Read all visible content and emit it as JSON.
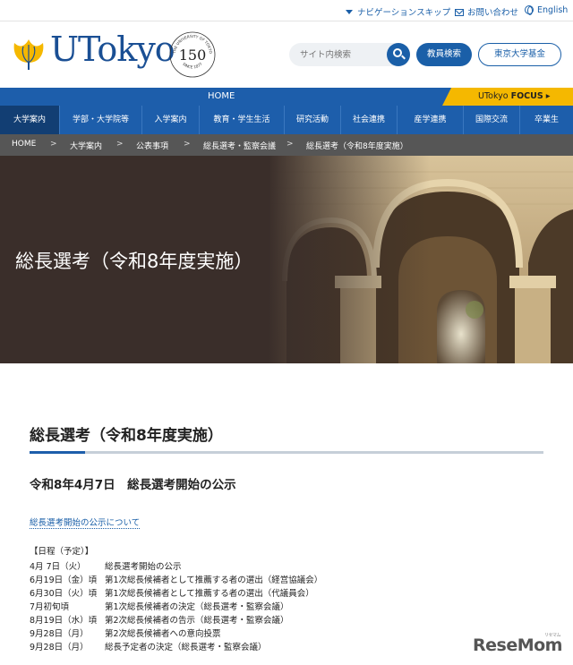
{
  "utility": {
    "skip_nav": "ナビゲーションスキップ",
    "contact": "お問い合わせ",
    "english": "English"
  },
  "header": {
    "logo_text": "UTokyo",
    "seal": {
      "top_text": "THE UNIVERSITY OF TOKYO",
      "number": "150",
      "bottom_text": "SINCE 1877"
    },
    "search_placeholder": "サイト内検索",
    "faculty_search": "教員検索",
    "fund": "東京大学基金"
  },
  "nav": {
    "home": "HOME",
    "focus_prefix": "UTokyo",
    "focus_label": "FOCUS",
    "items": [
      "大学案内",
      "学部・大学院等",
      "入学案内",
      "教育・学生生活",
      "研究活動",
      "社会連携",
      "産学連携",
      "国際交流",
      "卒業生"
    ]
  },
  "breadcrumb": [
    "HOME",
    "大学案内",
    "公表事項",
    "総長選考・監察会議",
    "総長選考（令和8年度実施）"
  ],
  "hero": {
    "title": "総長選考（令和8年度実施）"
  },
  "main": {
    "title": "総長選考（令和8年度実施）",
    "subtitle": "令和8年4月7日　総長選考開始の公示",
    "link": "総長選考開始の公示について",
    "schedule_heading": "【日程（予定）】",
    "schedule": [
      {
        "date": "4月 7日（火）",
        "event": "総長選考開始の公示"
      },
      {
        "date": "6月19日（金）頃",
        "event": "第1次総長候補者として推薦する者の選出（経営協議会）"
      },
      {
        "date": "6月30日（火）頃",
        "event": "第1次総長候補者として推薦する者の選出（代議員会）"
      },
      {
        "date": "7月初旬頃",
        "event": "第1次総長候補者の決定（総長選考・監察会議）"
      },
      {
        "date": "8月19日（水）頃",
        "event": "第2次総長候補者の告示（総長選考・監察会議）"
      },
      {
        "date": "9月28日（月）",
        "event": "第2次総長候補者への意向投票"
      },
      {
        "date": "9月28日（月）",
        "event": "総長予定者の決定（総長選考・監察会議）"
      }
    ]
  },
  "watermark": {
    "text": "ReseMom",
    "small": "リセマム"
  },
  "colors": {
    "primary": "#1d5eab",
    "focus": "#f5b800",
    "breadcrumb": "#565656",
    "nav_active": "#123e73"
  }
}
